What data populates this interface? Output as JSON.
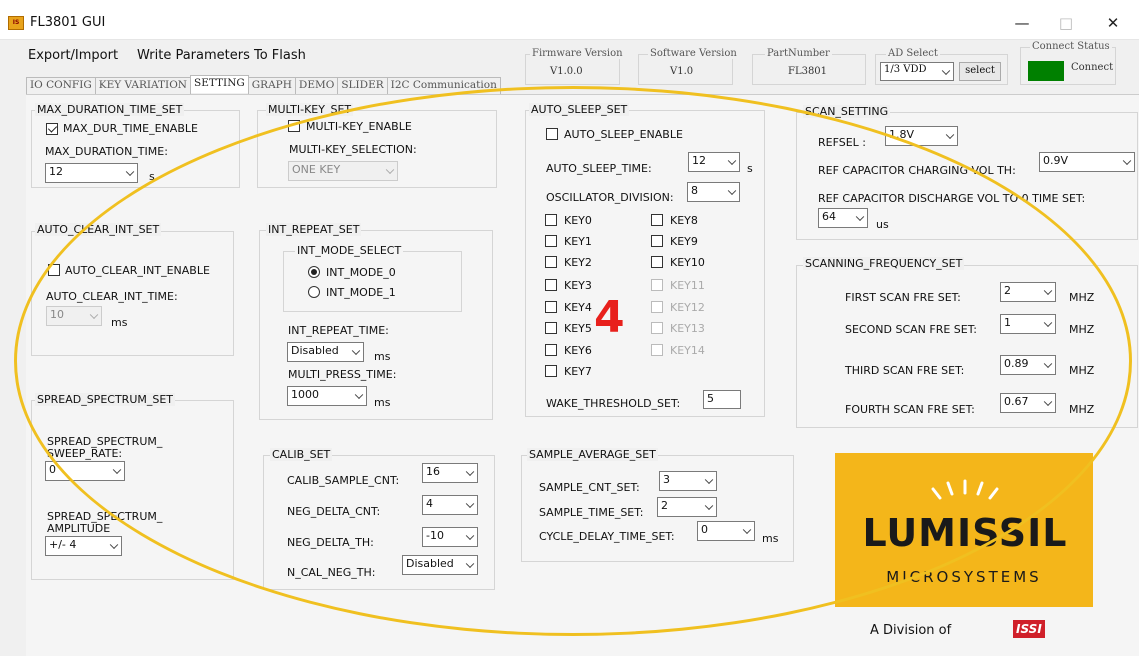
{
  "window": {
    "title": "FL3801 GUI",
    "app_icon": "app-icon",
    "minimize": "—",
    "maximize": "□",
    "close": "✕"
  },
  "menu": {
    "export_import": "Export/Import",
    "write_flash": "Write Parameters To Flash"
  },
  "tabs": [
    "IO CONFIG",
    "KEY VARIATION",
    "SETTING",
    "GRAPH",
    "DEMO",
    "SLIDER",
    "I2C Communication"
  ],
  "active_tab": "SETTING",
  "header": {
    "firmware_label": "Firmware Version",
    "firmware_value": "V1.0.0",
    "software_label": "Software Version",
    "software_value": "V1.0",
    "part_label": "PartNumber",
    "part_value": "FL3801",
    "ad_label": "AD Select",
    "ad_value": "1/3 VDD",
    "ad_button": "select",
    "connect_label": "Connect Status",
    "connect_button": "Connect",
    "connect_color": "#008000"
  },
  "max_duration": {
    "title": "MAX_DURATION_TIME_SET",
    "enable_label": "MAX_DUR_TIME_ENABLE",
    "enable_checked": true,
    "time_label": "MAX_DURATION_TIME:",
    "time_value": "12",
    "unit": "s"
  },
  "multikey": {
    "title": "MULTI-KEY_SET",
    "enable_label": "MULTI-KEY_ENABLE",
    "enable_checked": false,
    "sel_label": "MULTI-KEY_SELECTION:",
    "sel_value": "ONE KEY"
  },
  "auto_clear": {
    "title": "AUTO_CLEAR_INT_SET",
    "enable_label": "AUTO_CLEAR_INT_ENABLE",
    "enable_checked": false,
    "time_label": "AUTO_CLEAR_INT_TIME:",
    "time_value": "10",
    "unit": "ms"
  },
  "int_repeat": {
    "title": "INT_REPEAT_SET",
    "mode_title": "INT_MODE_SELECT",
    "mode0": "INT_MODE_0",
    "mode1": "INT_MODE_1",
    "selected_mode": "INT_MODE_0",
    "repeat_label": "INT_REPEAT_TIME:",
    "repeat_value": "Disabled",
    "repeat_unit": "ms",
    "multi_label": "MULTI_PRESS_TIME:",
    "multi_value": "1000",
    "multi_unit": "ms"
  },
  "spread": {
    "title": "SPREAD_SPECTRUM_SET",
    "rate_label1": "SPREAD_SPECTRUM_",
    "rate_label2": "SWEEP_RATE:",
    "rate_value": "0",
    "amp_label1": "SPREAD_SPECTRUM_",
    "amp_label2": "AMPLITUDE",
    "amp_value": "+/- 4"
  },
  "calib": {
    "title": "CALIB_SET",
    "rows": [
      {
        "label": "CALIB_SAMPLE_CNT:",
        "value": "16"
      },
      {
        "label": "NEG_DELTA_CNT:",
        "value": "4"
      },
      {
        "label": "NEG_DELTA_TH:",
        "value": "-10"
      },
      {
        "label": "N_CAL_NEG_TH:",
        "value": "Disabled"
      }
    ]
  },
  "auto_sleep": {
    "title": "AUTO_SLEEP_SET",
    "enable_label": "AUTO_SLEEP_ENABLE",
    "enable_checked": false,
    "time_label": "AUTO_SLEEP_TIME:",
    "time_value": "12",
    "time_unit": "s",
    "osc_label": "OSCILLATOR_DIVISION:",
    "osc_value": "8",
    "keys_left": [
      "KEY0",
      "KEY1",
      "KEY2",
      "KEY3",
      "KEY4",
      "KEY5",
      "KEY6",
      "KEY7"
    ],
    "keys_right": [
      "KEY8",
      "KEY9",
      "KEY10",
      "KEY11",
      "KEY12",
      "KEY13",
      "KEY14"
    ],
    "wake_label": "WAKE_THRESHOLD_SET:",
    "wake_value": "5"
  },
  "annotation": {
    "number": "4",
    "color": "#e8201c",
    "circle_color": "#f0c020"
  },
  "sample_avg": {
    "title": "SAMPLE_AVERAGE_SET",
    "cnt_label": "SAMPLE_CNT_SET:",
    "cnt_value": "3",
    "time_label": "SAMPLE_TIME_SET:",
    "time_value": "2",
    "delay_label": "CYCLE_DELAY_TIME_SET:",
    "delay_value": "0",
    "delay_unit": "ms"
  },
  "scan": {
    "title": "SCAN_SETTING",
    "refsel_label": "REFSEL :",
    "refsel_value": "1.8V",
    "charge_label": "REF CAPACITOR CHARGING VOL TH:",
    "charge_value": "0.9V",
    "discharge_label": "REF CAPACITOR DISCHARGE VOL TO 0 TIME SET:",
    "discharge_value": "64",
    "discharge_unit": "us"
  },
  "freq": {
    "title": "SCANNING_FREQUENCY_SET",
    "unit": "MHZ",
    "rows": [
      {
        "label": "FIRST SCAN FRE SET:",
        "value": "2"
      },
      {
        "label": "SECOND SCAN FRE SET:",
        "value": "1"
      },
      {
        "label": "THIRD SCAN FRE SET:",
        "value": "0.89"
      },
      {
        "label": "FOURTH SCAN FRE SET:",
        "value": "0.67"
      }
    ]
  },
  "logo": {
    "brand": "LUMISSIL",
    "sub": "MICROSYSTEMS",
    "division": "A Division of",
    "issi": "ISSI",
    "bg_color": "#f4b61a"
  }
}
